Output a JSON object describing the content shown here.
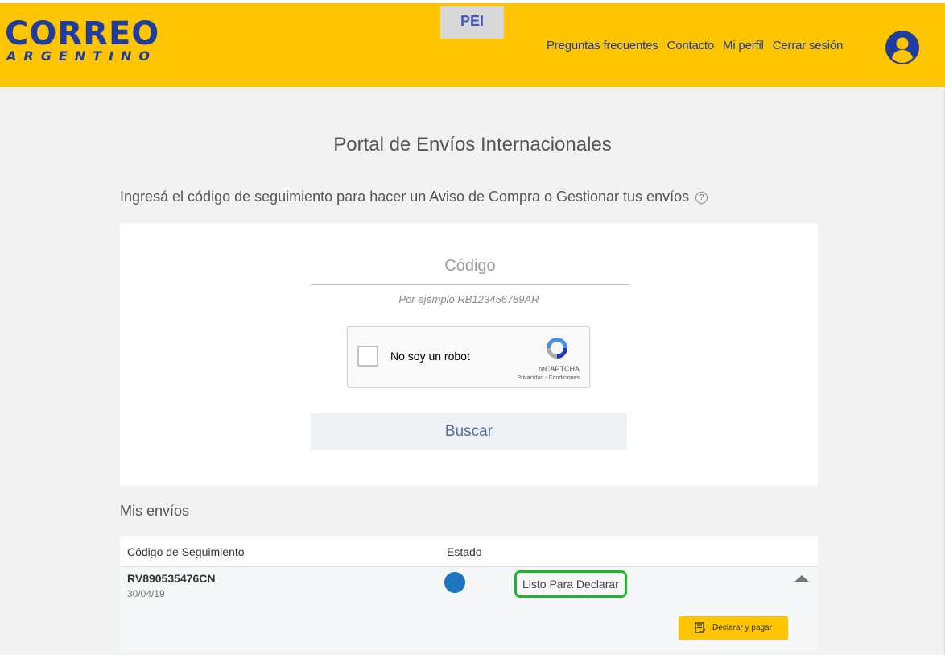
{
  "header": {
    "logo_main": "CORREO",
    "logo_sub": "ARGENTINO",
    "env_tag": "PEI",
    "nav": [
      "Preguntas frecuentes",
      "Contacto",
      "Mi perfil",
      "Cerrar sesión"
    ],
    "avatar_icon": "user-circle-icon",
    "brand_color": "#ffc600",
    "logo_color": "#1f3da0"
  },
  "main": {
    "title": "Portal de Envíos Internacionales",
    "instruction": "Ingresá el código de seguimiento para hacer un Aviso de Compra o Gestionar tus envíos",
    "help_icon": "question-circle-icon",
    "search": {
      "placeholder": "Código",
      "value": "",
      "hint": "Por ejemplo RB123456789AR",
      "captcha_label": "No soy un robot",
      "captcha_brand": "reCAPTCHA",
      "captcha_links": "Privacidad - Condiciones",
      "button_label": "Buscar"
    }
  },
  "shipments": {
    "title": "Mis envíos",
    "columns": [
      "Código de Seguimiento",
      "Estado"
    ],
    "rows": [
      {
        "code": "RV890535476CN",
        "date": "30/04/19",
        "status_color": "#1e74bd",
        "status": "Listo Para Declarar",
        "action_label": "Declarar y pagar",
        "action_icon": "document-check-icon",
        "toggle_icon": "chevron-up-icon"
      }
    ]
  }
}
